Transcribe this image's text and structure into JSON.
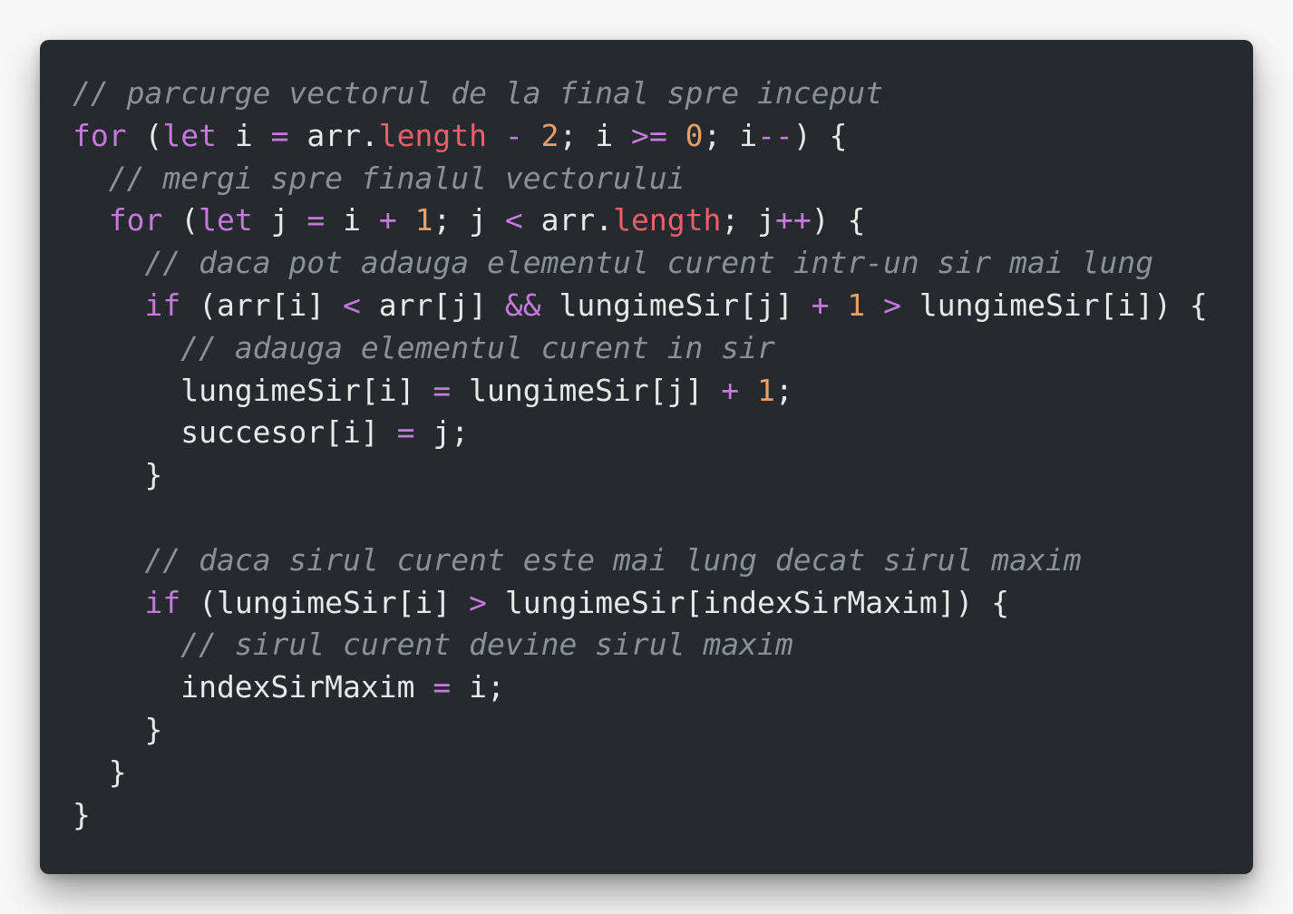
{
  "theme": {
    "background": "#f7f7f7",
    "editor_background": "#262a2e",
    "colors": {
      "comment": "#8b9096",
      "keyword": "#c678dd",
      "operator": "#c678dd",
      "property": "#ef5f6b",
      "number": "#e5a06b",
      "plain": "#e8e8e8"
    }
  },
  "code": {
    "language": "javascript",
    "lines": [
      [
        {
          "t": "comment",
          "v": "// parcurge vectorul de la final spre inceput"
        }
      ],
      [
        {
          "t": "keyword",
          "v": "for"
        },
        {
          "t": "plain",
          "v": " ("
        },
        {
          "t": "keyword",
          "v": "let"
        },
        {
          "t": "plain",
          "v": " i "
        },
        {
          "t": "operator",
          "v": "="
        },
        {
          "t": "plain",
          "v": " arr."
        },
        {
          "t": "property",
          "v": "length"
        },
        {
          "t": "plain",
          "v": " "
        },
        {
          "t": "operator",
          "v": "-"
        },
        {
          "t": "plain",
          "v": " "
        },
        {
          "t": "number",
          "v": "2"
        },
        {
          "t": "plain",
          "v": "; i "
        },
        {
          "t": "operator",
          "v": ">="
        },
        {
          "t": "plain",
          "v": " "
        },
        {
          "t": "number",
          "v": "0"
        },
        {
          "t": "plain",
          "v": "; i"
        },
        {
          "t": "operator",
          "v": "--"
        },
        {
          "t": "plain",
          "v": ") {"
        }
      ],
      [
        {
          "t": "plain",
          "v": "  "
        },
        {
          "t": "comment",
          "v": "// mergi spre finalul vectorului"
        }
      ],
      [
        {
          "t": "plain",
          "v": "  "
        },
        {
          "t": "keyword",
          "v": "for"
        },
        {
          "t": "plain",
          "v": " ("
        },
        {
          "t": "keyword",
          "v": "let"
        },
        {
          "t": "plain",
          "v": " j "
        },
        {
          "t": "operator",
          "v": "="
        },
        {
          "t": "plain",
          "v": " i "
        },
        {
          "t": "operator",
          "v": "+"
        },
        {
          "t": "plain",
          "v": " "
        },
        {
          "t": "number",
          "v": "1"
        },
        {
          "t": "plain",
          "v": "; j "
        },
        {
          "t": "operator",
          "v": "<"
        },
        {
          "t": "plain",
          "v": " arr."
        },
        {
          "t": "property",
          "v": "length"
        },
        {
          "t": "plain",
          "v": "; j"
        },
        {
          "t": "operator",
          "v": "++"
        },
        {
          "t": "plain",
          "v": ") {"
        }
      ],
      [
        {
          "t": "plain",
          "v": "    "
        },
        {
          "t": "comment",
          "v": "// daca pot adauga elementul curent intr-un sir mai lung"
        }
      ],
      [
        {
          "t": "plain",
          "v": "    "
        },
        {
          "t": "keyword",
          "v": "if"
        },
        {
          "t": "plain",
          "v": " (arr[i] "
        },
        {
          "t": "operator",
          "v": "<"
        },
        {
          "t": "plain",
          "v": " arr[j] "
        },
        {
          "t": "operator",
          "v": "&&"
        },
        {
          "t": "plain",
          "v": " lungimeSir[j] "
        },
        {
          "t": "operator",
          "v": "+"
        },
        {
          "t": "plain",
          "v": " "
        },
        {
          "t": "number",
          "v": "1"
        },
        {
          "t": "plain",
          "v": " "
        },
        {
          "t": "operator",
          "v": ">"
        },
        {
          "t": "plain",
          "v": " lungimeSir[i]) {"
        }
      ],
      [
        {
          "t": "plain",
          "v": "      "
        },
        {
          "t": "comment",
          "v": "// adauga elementul curent in sir"
        }
      ],
      [
        {
          "t": "plain",
          "v": "      lungimeSir[i] "
        },
        {
          "t": "operator",
          "v": "="
        },
        {
          "t": "plain",
          "v": " lungimeSir[j] "
        },
        {
          "t": "operator",
          "v": "+"
        },
        {
          "t": "plain",
          "v": " "
        },
        {
          "t": "number",
          "v": "1"
        },
        {
          "t": "plain",
          "v": ";"
        }
      ],
      [
        {
          "t": "plain",
          "v": "      succesor[i] "
        },
        {
          "t": "operator",
          "v": "="
        },
        {
          "t": "plain",
          "v": " j;"
        }
      ],
      [
        {
          "t": "plain",
          "v": "    }"
        }
      ],
      [],
      [
        {
          "t": "plain",
          "v": "    "
        },
        {
          "t": "comment",
          "v": "// daca sirul curent este mai lung decat sirul maxim"
        }
      ],
      [
        {
          "t": "plain",
          "v": "    "
        },
        {
          "t": "keyword",
          "v": "if"
        },
        {
          "t": "plain",
          "v": " (lungimeSir[i] "
        },
        {
          "t": "operator",
          "v": ">"
        },
        {
          "t": "plain",
          "v": " lungimeSir[indexSirMaxim]) {"
        }
      ],
      [
        {
          "t": "plain",
          "v": "      "
        },
        {
          "t": "comment",
          "v": "// sirul curent devine sirul maxim"
        }
      ],
      [
        {
          "t": "plain",
          "v": "      indexSirMaxim "
        },
        {
          "t": "operator",
          "v": "="
        },
        {
          "t": "plain",
          "v": " i;"
        }
      ],
      [
        {
          "t": "plain",
          "v": "    }"
        }
      ],
      [
        {
          "t": "plain",
          "v": "  }"
        }
      ],
      [
        {
          "t": "plain",
          "v": "}"
        }
      ]
    ]
  }
}
